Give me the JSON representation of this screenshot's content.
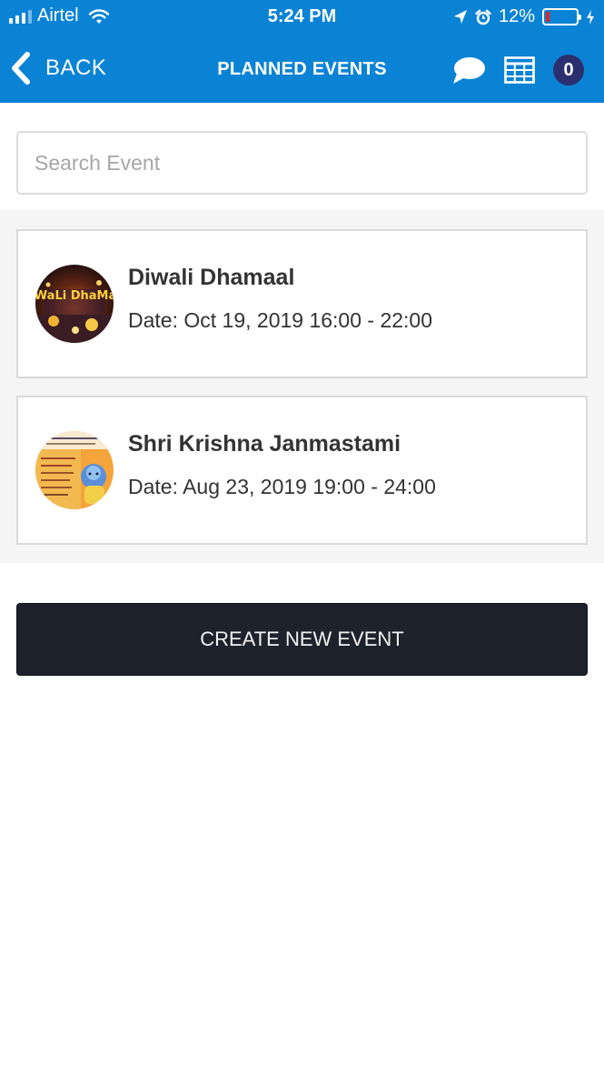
{
  "status_bar": {
    "carrier": "Airtel",
    "time": "5:24 PM",
    "battery_percent": "12%",
    "battery_level": 0.12
  },
  "header": {
    "back_label": "BACK",
    "title": "PLANNED EVENTS",
    "notification_count": "0",
    "icons": [
      "chevron-left-icon",
      "chat-bubble-icon",
      "calendar-grid-icon"
    ]
  },
  "search": {
    "placeholder": "Search Event",
    "value": ""
  },
  "events": [
    {
      "title": "Diwali Dhamaal",
      "date": "Date: Oct 19, 2019 16:00 - 22:00",
      "thumb_text": "DiWaLi DhaMaal"
    },
    {
      "title": "Shri Krishna Janmastami",
      "date": "Date: Aug 23, 2019 19:00 - 24:00"
    }
  ],
  "actions": {
    "create_label": "CREATE NEW EVENT"
  },
  "colors": {
    "header_blue": "#0b83d5",
    "badge": "#2c2f6f",
    "button_dark": "#1e222c",
    "list_bg": "#f5f5f5"
  }
}
